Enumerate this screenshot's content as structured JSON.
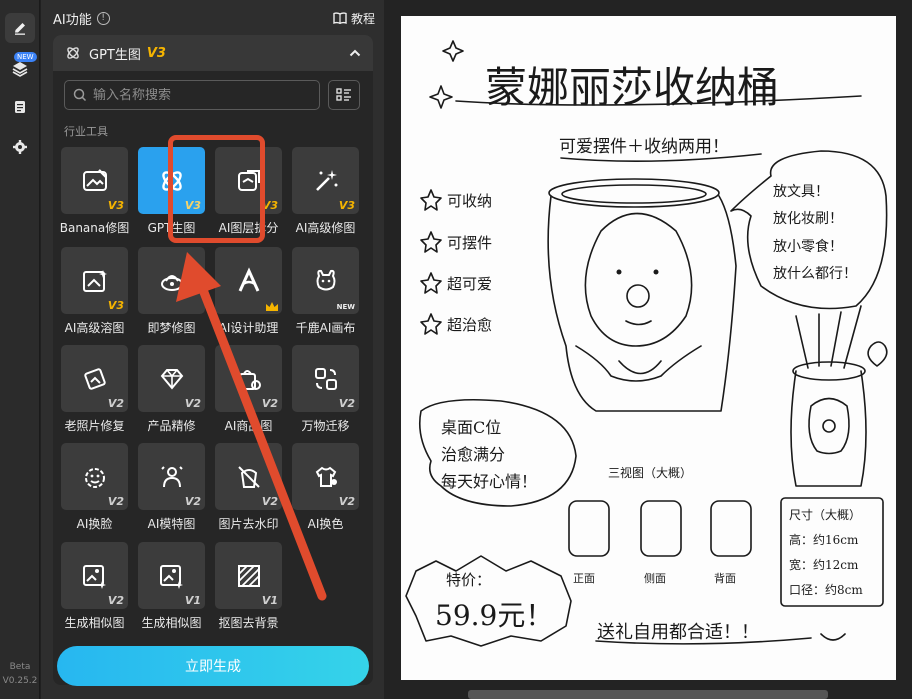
{
  "rail": {
    "new_badge": "NEW",
    "version_top": "Beta",
    "version_bottom": "V0.25.2"
  },
  "panel": {
    "title": "AI功能",
    "tutorial_label": "教程",
    "section": {
      "title": "GPT生图",
      "version": "V3"
    },
    "search_placeholder": "输入名称搜索",
    "category_label": "行业工具",
    "generate_label": "立即生成",
    "tools": [
      {
        "label": "Banana修图",
        "ver": "V3",
        "icon": "image-edit-icon"
      },
      {
        "label": "GPT生图",
        "ver": "V3",
        "icon": "gpt-logo-icon",
        "selected": true
      },
      {
        "label": "AI图层拆分",
        "ver": "V3",
        "icon": "layer-split-icon"
      },
      {
        "label": "AI高级修图",
        "ver": "V3",
        "icon": "magic-wand-icon"
      },
      {
        "label": "AI高级溶图",
        "ver": "V3",
        "icon": "image-sparkle-icon"
      },
      {
        "label": "即梦修图",
        "ver": "",
        "icon": "dream-edit-icon"
      },
      {
        "label": "AI设计助理",
        "ver": "",
        "icon": "design-assistant-icon",
        "badge": "crown"
      },
      {
        "label": "千鹿AI画布",
        "ver": "",
        "icon": "deer-canvas-icon",
        "badge": "NEW"
      },
      {
        "label": "老照片修复",
        "ver": "V2",
        "icon": "photo-restore-icon"
      },
      {
        "label": "产品精修",
        "ver": "V2",
        "icon": "diamond-icon"
      },
      {
        "label": "AI商品图",
        "ver": "V2",
        "icon": "product-bag-icon"
      },
      {
        "label": "万物迁移",
        "ver": "V2",
        "icon": "transfer-icon"
      },
      {
        "label": "AI换脸",
        "ver": "V2",
        "icon": "face-swap-icon"
      },
      {
        "label": "AI模特图",
        "ver": "V2",
        "icon": "model-person-icon"
      },
      {
        "label": "图片去水印",
        "ver": "V2",
        "icon": "remove-watermark-icon"
      },
      {
        "label": "AI换色",
        "ver": "V2",
        "icon": "recolor-icon"
      },
      {
        "label": "生成相似图",
        "ver": "V2",
        "icon": "similar-image-icon"
      },
      {
        "label": "生成相似图",
        "ver": "V1",
        "icon": "similar-image-icon"
      },
      {
        "label": "抠图去背景",
        "ver": "V1",
        "icon": "remove-bg-icon"
      }
    ]
  },
  "canvas": {
    "title": "蒙娜丽莎收纳桶",
    "subtitle": "可爱摆件＋收纳两用！",
    "features": [
      "可收纳",
      "可摆件",
      "超可爱",
      "超治愈"
    ],
    "bubble_right": [
      "放文具！",
      "放化妆刷！",
      "放小零食！",
      "放什么都行！"
    ],
    "bubble_left": [
      "桌面C位",
      "治愈满分",
      "每天好心情！"
    ],
    "three_view_title": "三视图（大概）",
    "views": [
      "正面",
      "侧面",
      "背面"
    ],
    "size_box": {
      "title": "尺寸（大概）",
      "lines": [
        "高：约16cm",
        "宽：约12cm",
        "口径：约8cm"
      ]
    },
    "price_label": "特价：",
    "price": "59.9元！",
    "footer": "送礼自用都合适！！"
  },
  "colors": {
    "accent": "#2aa1ee",
    "gold": "#f5b400",
    "arrow": "#e04b2d"
  }
}
